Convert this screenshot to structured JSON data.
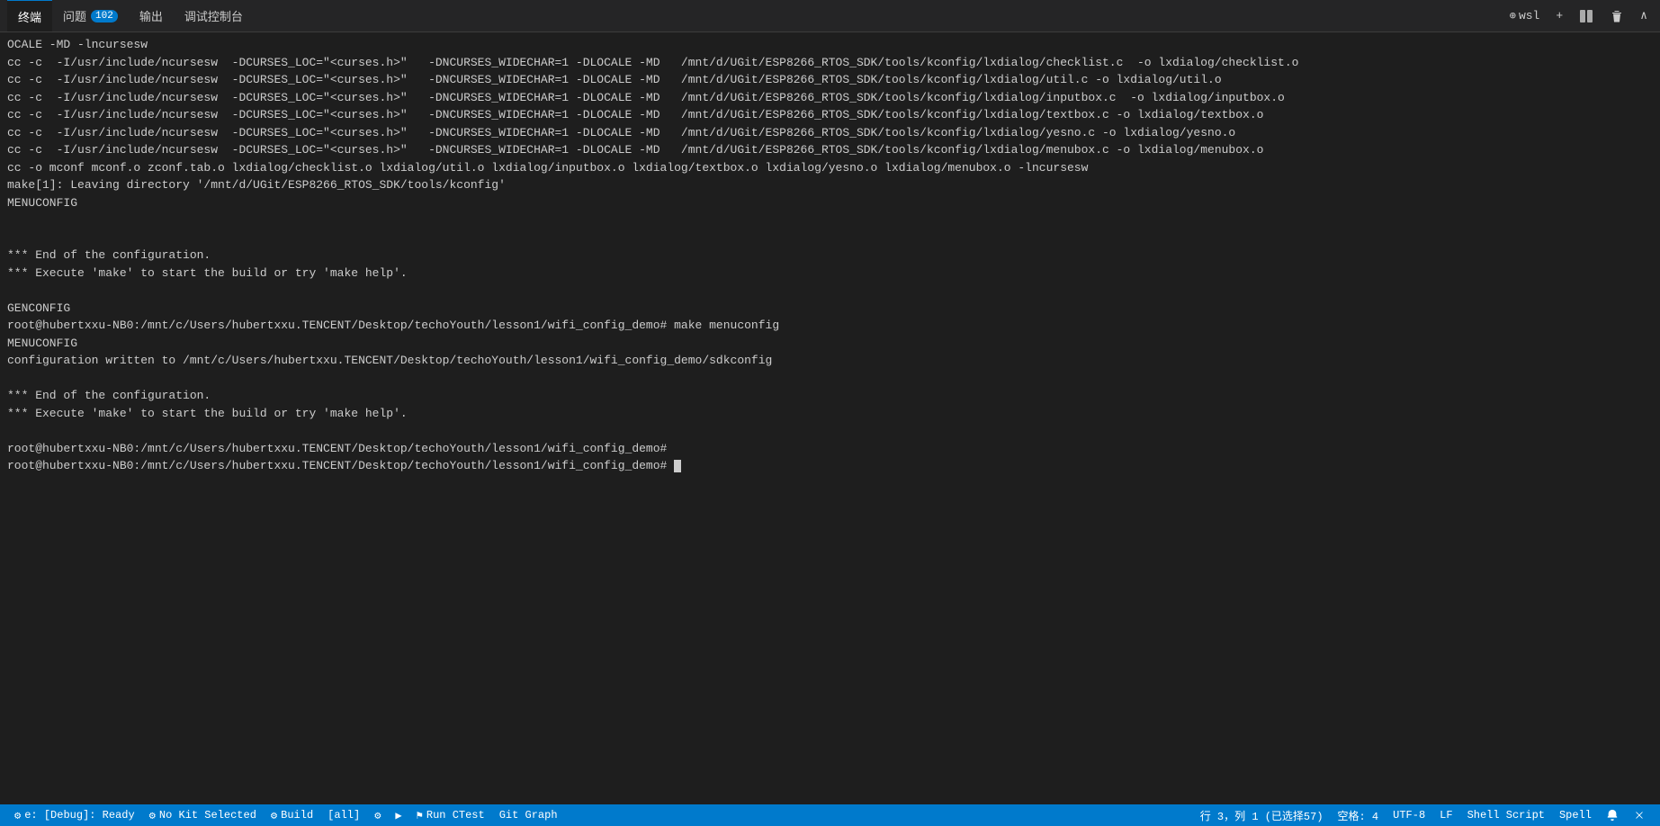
{
  "tabs": [
    {
      "id": "terminal",
      "label": "终端",
      "active": true
    },
    {
      "id": "problems",
      "label": "问题",
      "active": false
    },
    {
      "id": "output",
      "label": "输出",
      "active": false
    },
    {
      "id": "debug-console",
      "label": "调试控制台",
      "active": false
    }
  ],
  "problems_badge": "102",
  "tab_actions": {
    "wsl_label": "wsl",
    "add_label": "+",
    "split_label": "⊞",
    "trash_label": "🗑",
    "collapse_label": "∧"
  },
  "terminal_lines": [
    "OCALE -MD -lncursesw",
    "cc -c  -I/usr/include/ncursesw  -DCURSES_LOC=\"<curses.h>\"   -DNCURSES_WIDECHAR=1 -DLOCALE -MD   /mnt/d/UGit/ESP8266_RTOS_SDK/tools/kconfig/lxdialog/checklist.c  -o lxdialog/checklist.o",
    "cc -c  -I/usr/include/ncursesw  -DCURSES_LOC=\"<curses.h>\"   -DNCURSES_WIDECHAR=1 -DLOCALE -MD   /mnt/d/UGit/ESP8266_RTOS_SDK/tools/kconfig/lxdialog/util.c -o lxdialog/util.o",
    "cc -c  -I/usr/include/ncursesw  -DCURSES_LOC=\"<curses.h>\"   -DNCURSES_WIDECHAR=1 -DLOCALE -MD   /mnt/d/UGit/ESP8266_RTOS_SDK/tools/kconfig/lxdialog/inputbox.c  -o lxdialog/inputbox.o",
    "cc -c  -I/usr/include/ncursesw  -DCURSES_LOC=\"<curses.h>\"   -DNCURSES_WIDECHAR=1 -DLOCALE -MD   /mnt/d/UGit/ESP8266_RTOS_SDK/tools/kconfig/lxdialog/textbox.c -o lxdialog/textbox.o",
    "cc -c  -I/usr/include/ncursesw  -DCURSES_LOC=\"<curses.h>\"   -DNCURSES_WIDECHAR=1 -DLOCALE -MD   /mnt/d/UGit/ESP8266_RTOS_SDK/tools/kconfig/lxdialog/yesno.c -o lxdialog/yesno.o",
    "cc -c  -I/usr/include/ncursesw  -DCURSES_LOC=\"<curses.h>\"   -DNCURSES_WIDECHAR=1 -DLOCALE -MD   /mnt/d/UGit/ESP8266_RTOS_SDK/tools/kconfig/lxdialog/menubox.c -o lxdialog/menubox.o",
    "cc -o mconf mconf.o zconf.tab.o lxdialog/checklist.o lxdialog/util.o lxdialog/inputbox.o lxdialog/textbox.o lxdialog/yesno.o lxdialog/menubox.o -lncursesw",
    "make[1]: Leaving directory '/mnt/d/UGit/ESP8266_RTOS_SDK/tools/kconfig'",
    "MENUCONFIG",
    "",
    "",
    "*** End of the configuration.",
    "*** Execute 'make' to start the build or try 'make help'.",
    "",
    "GENCONFIG",
    "root@hubertxxu-NB0:/mnt/c/Users/hubertxxu.TENCENT/Desktop/techoYouth/lesson1/wifi_config_demo# make menuconfig",
    "MENUCONFIG",
    "configuration written to /mnt/c/Users/hubertxxu.TENCENT/Desktop/techoYouth/lesson1/wifi_config_demo/sdkconfig",
    "",
    "*** End of the configuration.",
    "*** Execute 'make' to start the build or try 'make help'.",
    "",
    "root@hubertxxu-NB0:/mnt/c/Users/hubertxxu.TENCENT/Desktop/techoYouth/lesson1/wifi_config_demo#",
    "root@hubertxxu-NB0:/mnt/c/Users/hubertxxu.TENCENT/Desktop/techoYouth/lesson1/wifi_config_demo# "
  ],
  "status_bar": {
    "debug_status": "e: [Debug]: Ready",
    "no_kit": "No Kit Selected",
    "build": "Build",
    "all_label": "[all]",
    "run_ctest": "Run CTest",
    "git_graph": "Git Graph",
    "position": "行 3，列 1 (已选择57)",
    "spaces": "空格: 4",
    "encoding": "UTF-8",
    "line_ending": "LF",
    "language": "Shell Script",
    "spell": "Spell",
    "notifications": "🔔"
  }
}
